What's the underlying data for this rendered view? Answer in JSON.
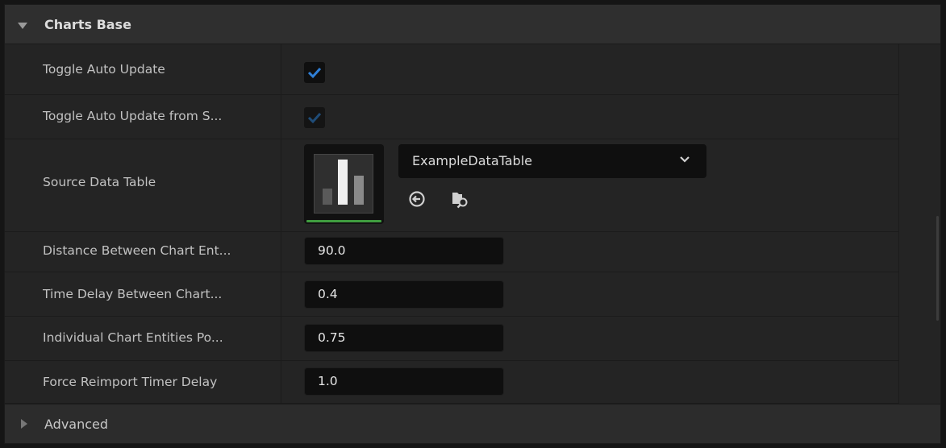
{
  "section": {
    "title": "Charts Base",
    "expanded": true
  },
  "properties": {
    "toggle_auto_update": {
      "label": "Toggle Auto Update",
      "checked": true
    },
    "toggle_auto_update_from_source": {
      "label": "Toggle Auto Update from S...",
      "checked": true,
      "enabled": false
    },
    "source_data_table": {
      "label": "Source Data Table",
      "asset_value": "ExampleDataTable",
      "thumbnail_icon": "bar-chart-icon"
    },
    "distance_between_chart_entities": {
      "label": "Distance Between Chart Ent...",
      "value": "90.0"
    },
    "time_delay_between_chart": {
      "label": "Time Delay Between Chart...",
      "value": "0.4"
    },
    "individual_chart_entities": {
      "label": "Individual Chart Entities Po...",
      "value": "0.75"
    },
    "force_reimport_timer_delay": {
      "label": "Force Reimport Timer Delay",
      "value": "1.0"
    }
  },
  "advanced": {
    "title": "Advanced",
    "expanded": false
  },
  "colors": {
    "check_accent": "#2f7fd6",
    "thumbnail_underline": "#3f9c3f",
    "panel_bg": "#242424"
  }
}
